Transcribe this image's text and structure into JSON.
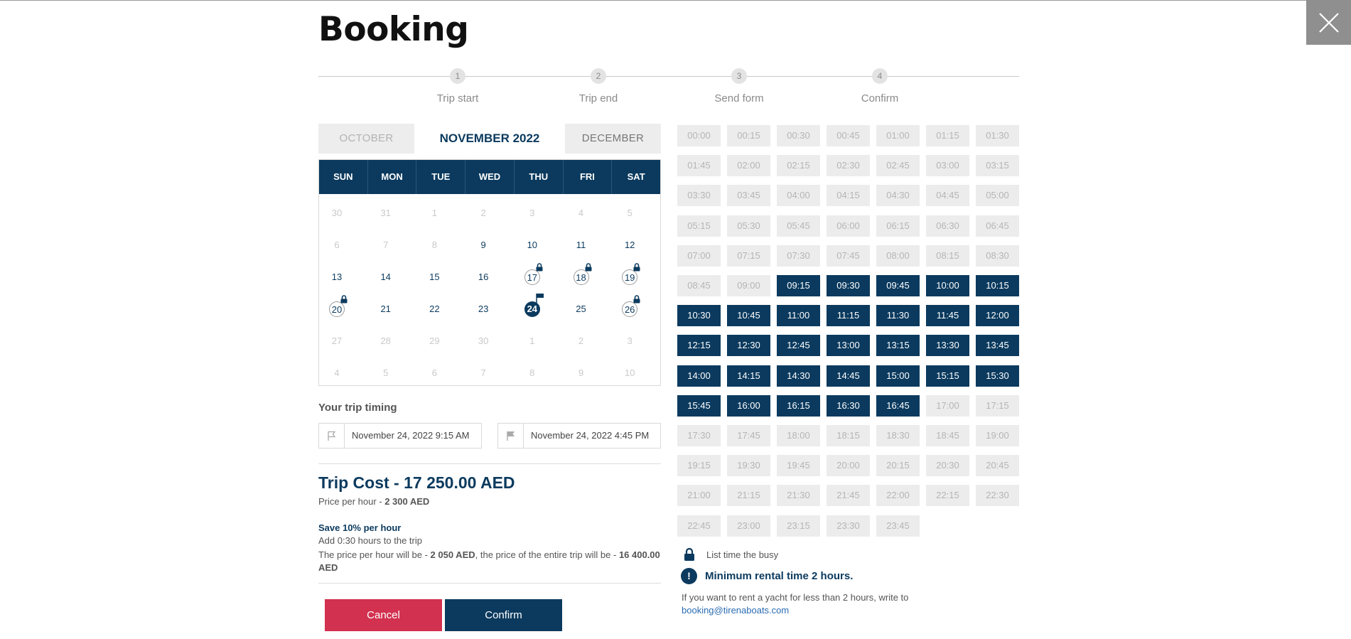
{
  "header": {
    "title": "Booking"
  },
  "steps": [
    {
      "num": "1",
      "label": "Trip start"
    },
    {
      "num": "2",
      "label": "Trip end"
    },
    {
      "num": "3",
      "label": "Send form"
    },
    {
      "num": "4",
      "label": "Confirm"
    }
  ],
  "months": {
    "prev": "OCTOBER",
    "current": "NOVEMBER 2022",
    "next": "DECEMBER"
  },
  "weekdays": [
    "SUN",
    "MON",
    "TUE",
    "WED",
    "THU",
    "FRI",
    "SAT"
  ],
  "calendar": [
    [
      {
        "d": "30",
        "s": "muted"
      },
      {
        "d": "31",
        "s": "muted"
      },
      {
        "d": "1",
        "s": "muted"
      },
      {
        "d": "2",
        "s": "muted"
      },
      {
        "d": "3",
        "s": "muted"
      },
      {
        "d": "4",
        "s": "muted"
      },
      {
        "d": "5",
        "s": "muted"
      }
    ],
    [
      {
        "d": "6",
        "s": "muted"
      },
      {
        "d": "7",
        "s": "muted"
      },
      {
        "d": "8",
        "s": "muted"
      },
      {
        "d": "9",
        "s": "active"
      },
      {
        "d": "10",
        "s": "active"
      },
      {
        "d": "11",
        "s": "active"
      },
      {
        "d": "12",
        "s": "active"
      }
    ],
    [
      {
        "d": "13",
        "s": "active"
      },
      {
        "d": "14",
        "s": "active"
      },
      {
        "d": "15",
        "s": "active"
      },
      {
        "d": "16",
        "s": "active"
      },
      {
        "d": "17",
        "s": "busy"
      },
      {
        "d": "18",
        "s": "busy"
      },
      {
        "d": "19",
        "s": "busy"
      }
    ],
    [
      {
        "d": "20",
        "s": "busy"
      },
      {
        "d": "21",
        "s": "active"
      },
      {
        "d": "22",
        "s": "active"
      },
      {
        "d": "23",
        "s": "active"
      },
      {
        "d": "24",
        "s": "sel"
      },
      {
        "d": "25",
        "s": "active"
      },
      {
        "d": "26",
        "s": "busy"
      }
    ],
    [
      {
        "d": "27",
        "s": "muted"
      },
      {
        "d": "28",
        "s": "muted"
      },
      {
        "d": "29",
        "s": "muted"
      },
      {
        "d": "30",
        "s": "muted"
      },
      {
        "d": "1",
        "s": "muted"
      },
      {
        "d": "2",
        "s": "muted"
      },
      {
        "d": "3",
        "s": "muted"
      }
    ],
    [
      {
        "d": "4",
        "s": "muted"
      },
      {
        "d": "5",
        "s": "muted"
      },
      {
        "d": "6",
        "s": "muted"
      },
      {
        "d": "7",
        "s": "muted"
      },
      {
        "d": "8",
        "s": "muted"
      },
      {
        "d": "9",
        "s": "muted"
      },
      {
        "d": "10",
        "s": "muted"
      }
    ]
  ],
  "timing": {
    "label": "Your trip timing",
    "start": "November 24, 2022 9:15 AM",
    "end": "November 24, 2022 4:45 PM"
  },
  "cost": {
    "title": "Trip Cost - 17 250.00 AED",
    "per_hour_label": "Price per hour - ",
    "per_hour_value": "2 300 AED",
    "save_title": "Save 10% per hour",
    "save_add": "Add 0:30 hours to the trip",
    "note_a": "The price per hour will be - ",
    "note_b": "2 050 AED",
    "note_c": ", the price of the entire trip will be - ",
    "note_d": "16 400.00 AED"
  },
  "buttons": {
    "cancel": "Cancel",
    "confirm": "Confirm"
  },
  "times": {
    "slots": [
      "00:00",
      "00:15",
      "00:30",
      "00:45",
      "01:00",
      "01:15",
      "01:30",
      "01:45",
      "02:00",
      "02:15",
      "02:30",
      "02:45",
      "03:00",
      "03:15",
      "03:30",
      "03:45",
      "04:00",
      "04:15",
      "04:30",
      "04:45",
      "05:00",
      "05:15",
      "05:30",
      "05:45",
      "06:00",
      "06:15",
      "06:30",
      "06:45",
      "07:00",
      "07:15",
      "07:30",
      "07:45",
      "08:00",
      "08:15",
      "08:30",
      "08:45",
      "09:00",
      "09:15",
      "09:30",
      "09:45",
      "10:00",
      "10:15",
      "10:30",
      "10:45",
      "11:00",
      "11:15",
      "11:30",
      "11:45",
      "12:00",
      "12:15",
      "12:30",
      "12:45",
      "13:00",
      "13:15",
      "13:30",
      "13:45",
      "14:00",
      "14:15",
      "14:30",
      "14:45",
      "15:00",
      "15:15",
      "15:30",
      "15:45",
      "16:00",
      "16:15",
      "16:30",
      "16:45",
      "17:00",
      "17:15",
      "17:30",
      "17:45",
      "18:00",
      "18:15",
      "18:30",
      "18:45",
      "19:00",
      "19:15",
      "19:30",
      "19:45",
      "20:00",
      "20:15",
      "20:30",
      "20:45",
      "21:00",
      "21:15",
      "21:30",
      "21:45",
      "22:00",
      "22:15",
      "22:30",
      "22:45",
      "23:00",
      "23:15",
      "23:30",
      "23:45"
    ],
    "selected_from": "09:15",
    "selected_to": "16:45"
  },
  "legend": {
    "busy": "List time the busy"
  },
  "min_rental": {
    "title": "Minimum rental time 2 hours.",
    "note": "If you want to rent a yacht for less than 2 hours, write to",
    "email": "booking@tirenaboats.com"
  },
  "colors": {
    "primary": "#0b3a5e",
    "cancel": "#d23150",
    "close_bg": "#8f8f8f"
  }
}
